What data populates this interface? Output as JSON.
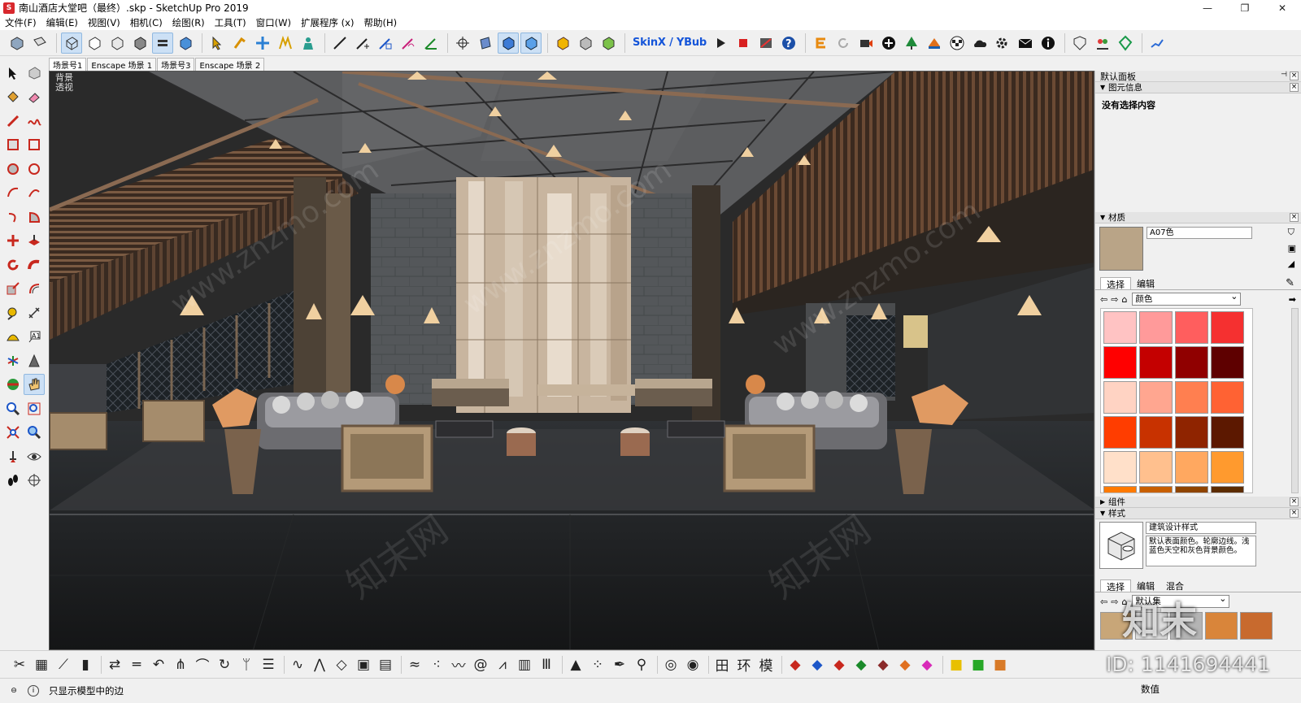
{
  "window": {
    "title": "南山酒店大堂吧（最终）.skp - SketchUp Pro 2019",
    "minimize": "—",
    "restore": "❐",
    "close": "✕"
  },
  "menu": [
    "文件(F)",
    "编辑(E)",
    "视图(V)",
    "相机(C)",
    "绘图(R)",
    "工具(T)",
    "窗口(W)",
    "扩展程序 (x)",
    "帮助(H)"
  ],
  "toolbar": {
    "skinx_label": "SkinX / YBub"
  },
  "scenes": [
    "场景号1",
    "Enscape 场景 1",
    "场景号3",
    "Enscape 场景 2"
  ],
  "viewport": {
    "style_label": "背景",
    "camera_label": "透视"
  },
  "watermark": {
    "site": "www.znzmo.com",
    "brand": "知末网",
    "id_text": "ID: 1141694441",
    "logo_text": "知末"
  },
  "tray": {
    "title": "默认面板"
  },
  "entity_info": {
    "title": "图元信息",
    "empty_text": "没有选择内容"
  },
  "materials": {
    "title": "材质",
    "current_name": "A07色",
    "tab_select": "选择",
    "tab_edit": "编辑",
    "library": "颜色",
    "swatches": [
      "#ffc3c3",
      "#ff9a9a",
      "#ff5e5e",
      "#f53030",
      "#ff0000",
      "#c40000",
      "#900000",
      "#5e0000",
      "#ffd3c3",
      "#ffa690",
      "#ff7f50",
      "#ff6233",
      "#ff3d00",
      "#c83200",
      "#8f2400",
      "#5c1800",
      "#ffe0c9",
      "#ffc08e",
      "#ffa860",
      "#ff9a2e",
      "#ff7a00",
      "#c85f00",
      "#8f4400",
      "#5c2c00"
    ]
  },
  "components": {
    "title": "组件"
  },
  "styles": {
    "title": "样式",
    "name": "建筑设计样式",
    "description": "默认表面颜色。轮廓边线。浅蓝色天空和灰色背景颜色。",
    "tab_select": "选择",
    "tab_edit": "编辑",
    "tab_mix": "混合",
    "collection": "默认集"
  },
  "status": {
    "hint": "只显示模型中的边",
    "measurement_label": "数值"
  }
}
